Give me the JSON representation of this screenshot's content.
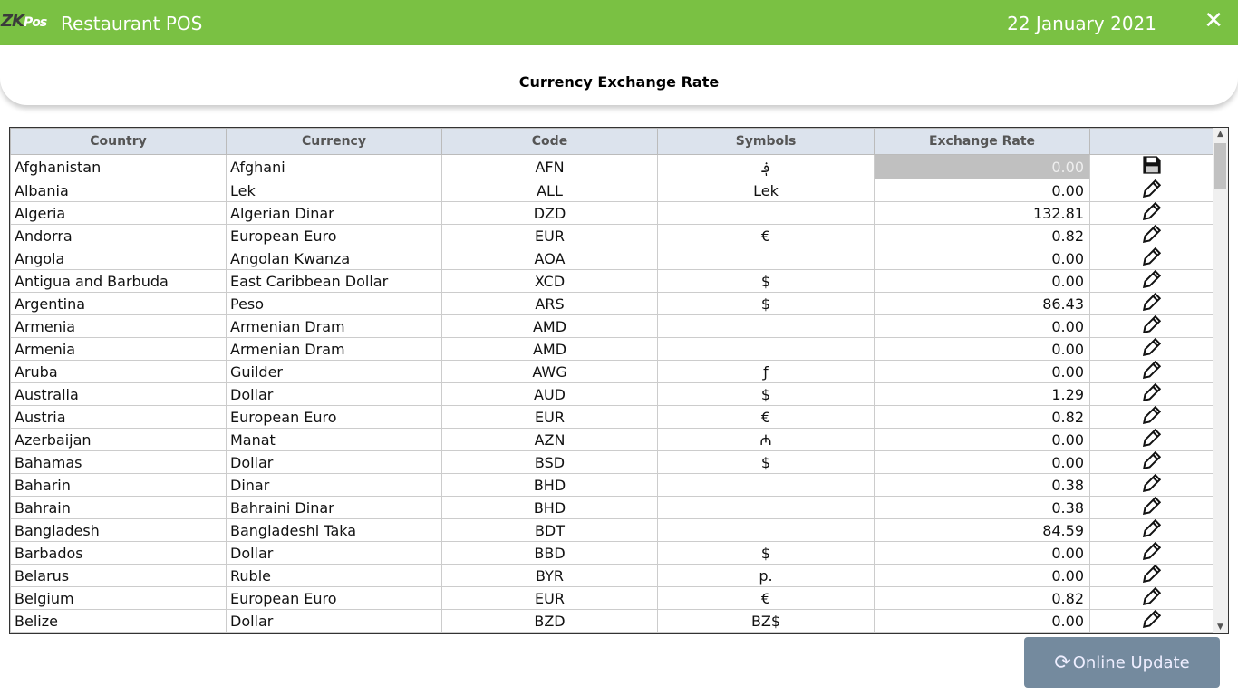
{
  "app": {
    "logo": "ZKPos",
    "title": "Restaurant POS",
    "date": "22 January 2021",
    "close_icon": "close-icon"
  },
  "page": {
    "title": "Currency Exchange Rate"
  },
  "table": {
    "columns": [
      "Country",
      "Currency",
      "Code",
      "Symbols",
      "Exchange Rate",
      ""
    ],
    "rows": [
      [
        "Afghanistan",
        "Afghani",
        "AFN",
        "؋",
        "0.00",
        "save"
      ],
      [
        "Albania",
        "Lek",
        "ALL",
        "Lek",
        "0.00",
        "edit"
      ],
      [
        "Algeria",
        "Algerian Dinar",
        "DZD",
        "",
        "132.81",
        "edit"
      ],
      [
        "Andorra",
        "European Euro",
        "EUR",
        "€",
        "0.82",
        "edit"
      ],
      [
        "Angola",
        "Angolan Kwanza",
        "AOA",
        "",
        "0.00",
        "edit"
      ],
      [
        "Antigua and Barbuda",
        "East Caribbean Dollar",
        "XCD",
        "$",
        "0.00",
        "edit"
      ],
      [
        "Argentina",
        "Peso",
        "ARS",
        "$",
        "86.43",
        "edit"
      ],
      [
        "Armenia",
        "Armenian Dram",
        "AMD",
        "",
        "0.00",
        "edit"
      ],
      [
        "Armenia",
        "Armenian Dram",
        "AMD",
        "",
        "0.00",
        "edit"
      ],
      [
        "Aruba",
        "Guilder",
        "AWG",
        "ƒ",
        "0.00",
        "edit"
      ],
      [
        "Australia",
        "Dollar",
        "AUD",
        "$",
        "1.29",
        "edit"
      ],
      [
        "Austria",
        "European Euro",
        "EUR",
        "€",
        "0.82",
        "edit"
      ],
      [
        "Azerbaijan",
        "Manat",
        "AZN",
        "₼",
        "0.00",
        "edit"
      ],
      [
        "Bahamas",
        "Dollar",
        "BSD",
        "$",
        "0.00",
        "edit"
      ],
      [
        "Baharin",
        "Dinar",
        "BHD",
        "",
        "0.38",
        "edit"
      ],
      [
        "Bahrain",
        "Bahraini Dinar",
        "BHD",
        "",
        "0.38",
        "edit"
      ],
      [
        "Bangladesh",
        "Bangladeshi Taka",
        "BDT",
        "",
        "84.59",
        "edit"
      ],
      [
        "Barbados",
        "Dollar",
        "BBD",
        "$",
        "0.00",
        "edit"
      ],
      [
        "Belarus",
        "Ruble",
        "BYR",
        "p.",
        "0.00",
        "edit"
      ],
      [
        "Belgium",
        "European Euro",
        "EUR",
        "€",
        "0.82",
        "edit"
      ],
      [
        "Belize",
        "Dollar",
        "BZD",
        "BZ$",
        "0.00",
        "edit"
      ]
    ]
  },
  "button": {
    "label": "Online Update",
    "icon": "refresh-icon"
  }
}
